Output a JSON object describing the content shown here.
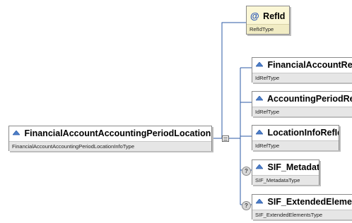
{
  "root": {
    "name": "FinancialAccountAccountingPeriodLocationInfo",
    "type": "FinancialAccountAccountingPeriodLocationInfoType",
    "icon": "element-icon"
  },
  "attribute": {
    "prefix": "@",
    "name": "RefId",
    "type": "RefIdType"
  },
  "children": [
    {
      "name": "FinancialAccountRefId",
      "type": "IdRefType",
      "optional": false,
      "icon": "element-icon"
    },
    {
      "name": "AccountingPeriodRefId",
      "type": "IdRefType",
      "optional": false,
      "icon": "element-icon"
    },
    {
      "name": "LocationInfoRefId",
      "type": "IdRefType",
      "optional": false,
      "icon": "element-icon"
    },
    {
      "name": "SIF_Metadata",
      "type": "SIF_MetadataType",
      "optional": true,
      "optional_glyph": "?",
      "icon": "element-icon"
    },
    {
      "name": "SIF_ExtendedElements",
      "type": "SIF_ExtendedElementsType",
      "optional": true,
      "optional_glyph": "?",
      "icon": "element-icon"
    }
  ],
  "colors": {
    "connector_line": "#2b5aa6",
    "attribute_bg": "#fbf7d6",
    "type_bar_bg": "#e6e6e6",
    "node_border": "#8a8a8a"
  }
}
